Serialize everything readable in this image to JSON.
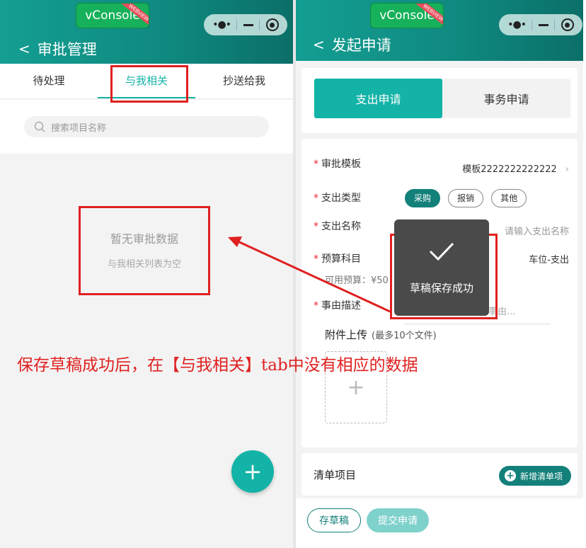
{
  "left": {
    "vconsole": {
      "label": "vConsole",
      "ribbon": "WEBVIEW"
    },
    "nav": {
      "back_icon": "chevron-left-icon",
      "title": "审批管理"
    },
    "tabs": [
      {
        "label": "待处理"
      },
      {
        "label": "与我相关",
        "active": true
      },
      {
        "label": "抄送给我"
      }
    ],
    "search": {
      "placeholder": "搜索项目名称",
      "icon": "search-icon"
    },
    "empty": {
      "title": "暂无审批数据",
      "subtitle": "与我相关列表为空"
    },
    "fab": {
      "label": "+"
    }
  },
  "right": {
    "vconsole": {
      "label": "vConsole",
      "ribbon": "WEBVIEW"
    },
    "nav": {
      "back_icon": "chevron-left-icon",
      "title": "发起申请"
    },
    "segments": [
      {
        "label": "支出申请",
        "active": true
      },
      {
        "label": "事务申请"
      }
    ],
    "form": {
      "template": {
        "label": "审批模板",
        "value": "模板2222222222222"
      },
      "expense_type": {
        "label": "支出类型",
        "options": [
          "采购",
          "报销",
          "其他"
        ],
        "selected": "采购"
      },
      "expense_name": {
        "label": "支出名称",
        "placeholder": "请输入支出名称"
      },
      "budget": {
        "label": "预算科目",
        "value": "车位-支出",
        "available": "可用预算：¥50"
      },
      "reason": {
        "label": "事由描述",
        "placeholder": "事由..."
      },
      "attachment": {
        "label": "附件上传",
        "hint": "(最多10个文件)",
        "add": "+"
      }
    },
    "list": {
      "label": "清单项目",
      "add_button": "新增清单项"
    },
    "actions": {
      "draft": "存草稿",
      "submit": "提交申请"
    },
    "toast": {
      "message": "草稿保存成功",
      "icon": "check-icon"
    }
  },
  "annotation": {
    "caption": "保存草稿成功后，在【与我相关】tab中没有相应的数据",
    "color": "#e02020"
  },
  "theme": {
    "header": "#0f8a80",
    "accent": "#14b3a7",
    "dark_accent": "#13807a"
  }
}
